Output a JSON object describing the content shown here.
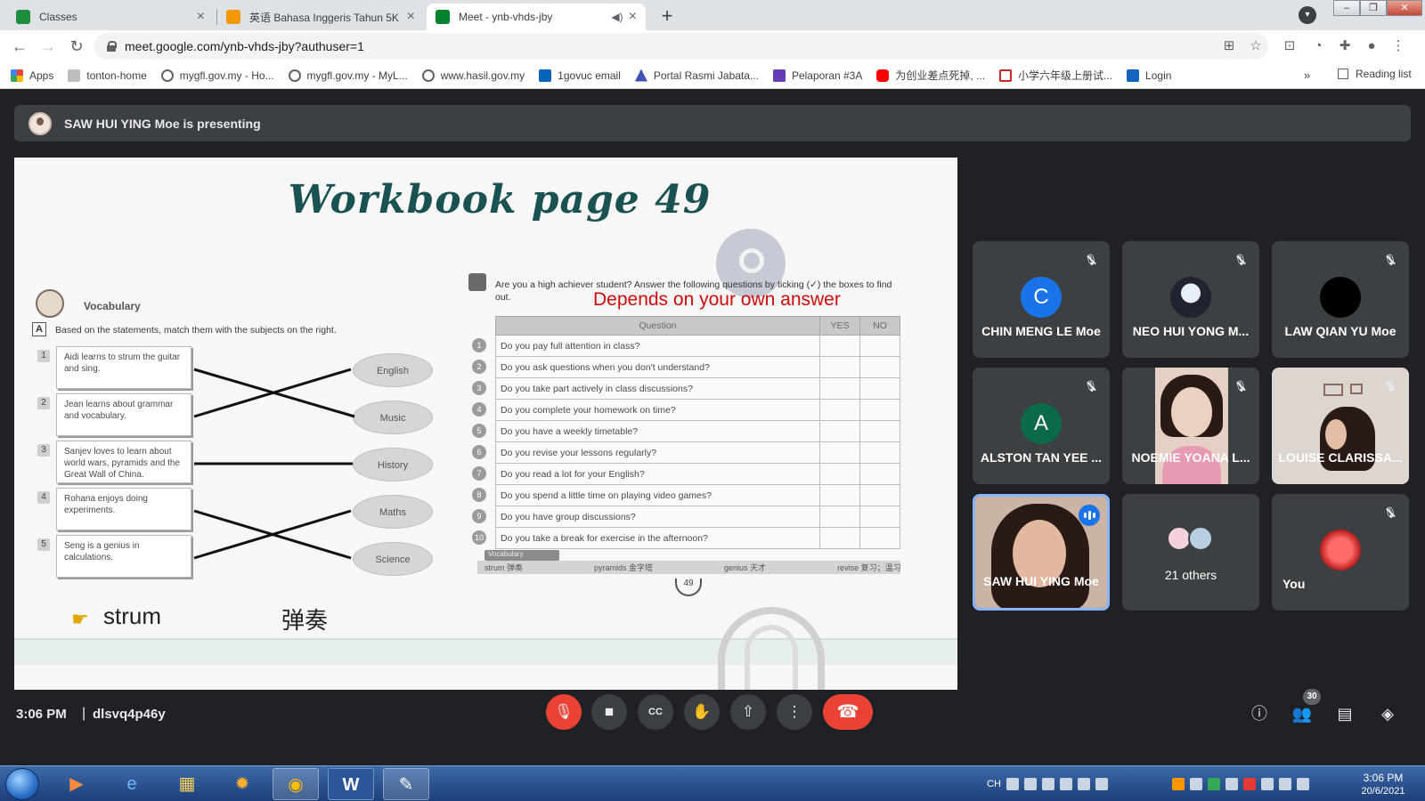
{
  "browser": {
    "tabs": [
      {
        "title": "Classes",
        "icon": "google-classroom-icon",
        "color": "#1e8e3e",
        "active": false
      },
      {
        "title": "英语 Bahasa Inggeris Tahun 5K",
        "icon": "google-classroom-icon",
        "color": "#f29900",
        "active": false
      },
      {
        "title": "Meet - ynb-vhds-jby",
        "icon": "google-meet-icon",
        "color": "#00832d",
        "active": true
      }
    ],
    "url": "meet.google.com/ynb-vhds-jby?authuser=1",
    "bookmarks": [
      {
        "label": "Apps",
        "icon": "apps-grid-icon"
      },
      {
        "label": "tonton-home",
        "icon": "tonton-icon"
      },
      {
        "label": "mygfl.gov.my - Ho...",
        "icon": "globe-icon"
      },
      {
        "label": "mygfl.gov.my - MyL...",
        "icon": "globe-icon"
      },
      {
        "label": "www.hasil.gov.my",
        "icon": "globe-icon"
      },
      {
        "label": "1govuc email",
        "icon": "outlook-icon"
      },
      {
        "label": "Portal Rasmi Jabata...",
        "icon": "portal-icon"
      },
      {
        "label": "Pelaporan #3A",
        "icon": "forms-icon"
      },
      {
        "label": "为创业差点死掉, ...",
        "icon": "youtube-icon"
      },
      {
        "label": "小学六年级上册试...",
        "icon": "document-icon"
      },
      {
        "label": "Login",
        "icon": "login-icon"
      }
    ],
    "bookmarks_more": "»",
    "reading_list": "Reading list"
  },
  "meet": {
    "presenting": "SAW HUI YING Moe is presenting",
    "time": "3:06 PM",
    "meeting_code": "dlsvq4p46y",
    "people_count": "30",
    "participants": [
      {
        "name": "CHIN MENG LE Moe",
        "initial": "C",
        "avatar_color": "#1a73e8",
        "muted": true
      },
      {
        "name": "NEO HUI YONG M...",
        "initial": "",
        "avatar_color": "#2b2f3a",
        "muted": true
      },
      {
        "name": "LAW QIAN YU Moe",
        "initial": "",
        "avatar_color": "#000000",
        "muted": true
      },
      {
        "name": "ALSTON TAN YEE ...",
        "initial": "A",
        "avatar_color": "#0b6b48",
        "muted": true
      },
      {
        "name": "NOEMIE YOANA L...",
        "video": true,
        "muted": true
      },
      {
        "name": "LOUISE CLARISSA...",
        "video": true,
        "muted": true
      },
      {
        "name": "SAW HUI YING Moe",
        "video": true,
        "speaking": true
      },
      {
        "name": "21 others",
        "others": true
      },
      {
        "name": "You",
        "muted": true
      }
    ]
  },
  "slide": {
    "title": "Workbook page 49",
    "vocab_label": "Vocabulary",
    "section_a": "A",
    "instruction_a": "Based on the statements, match them with the subjects on the right.",
    "statements": [
      {
        "num": "1",
        "text": "Aidi learns to strum the guitar and sing."
      },
      {
        "num": "2",
        "text": "Jean learns about grammar and vocabulary."
      },
      {
        "num": "3",
        "text": "Sanjev loves to learn about world wars, pyramids and the Great Wall of China."
      },
      {
        "num": "4",
        "text": "Rohana enjoys doing experiments."
      },
      {
        "num": "5",
        "text": "Seng is a genius in calculations."
      }
    ],
    "subjects": [
      "English",
      "Music",
      "History",
      "Maths",
      "Science"
    ],
    "question_intro": "Are you a high achiever student? Answer the following questions by ticking (✓) the boxes to find out.",
    "annotation": "Depends on your own answer",
    "table_header": {
      "question": "Question",
      "yes": "YES",
      "no": "NO"
    },
    "questions": [
      "Do you pay full attention in class?",
      "Do you ask questions when you don't understand?",
      "Do you take part actively in class discussions?",
      "Do you complete your homework on time?",
      "Do you have a weekly timetable?",
      "Do you revise your lessons regularly?",
      "Do you read a lot for your English?",
      "Do you spend a little time on playing video games?",
      "Do you have group discussions?",
      "Do you take a break for exercise in the afternoon?"
    ],
    "vocab_tag": "Vocabulary",
    "vocab_strip": [
      "strum 弹奏",
      "pyramids 金字塔",
      "genius 天才",
      "revise 复习；温习"
    ],
    "page_number": "49",
    "strum_word": "strum",
    "strum_chinese": "弹奏"
  },
  "taskbar": {
    "language": "CH",
    "clock_time": "3:06 PM",
    "clock_date": "20/6/2021"
  }
}
